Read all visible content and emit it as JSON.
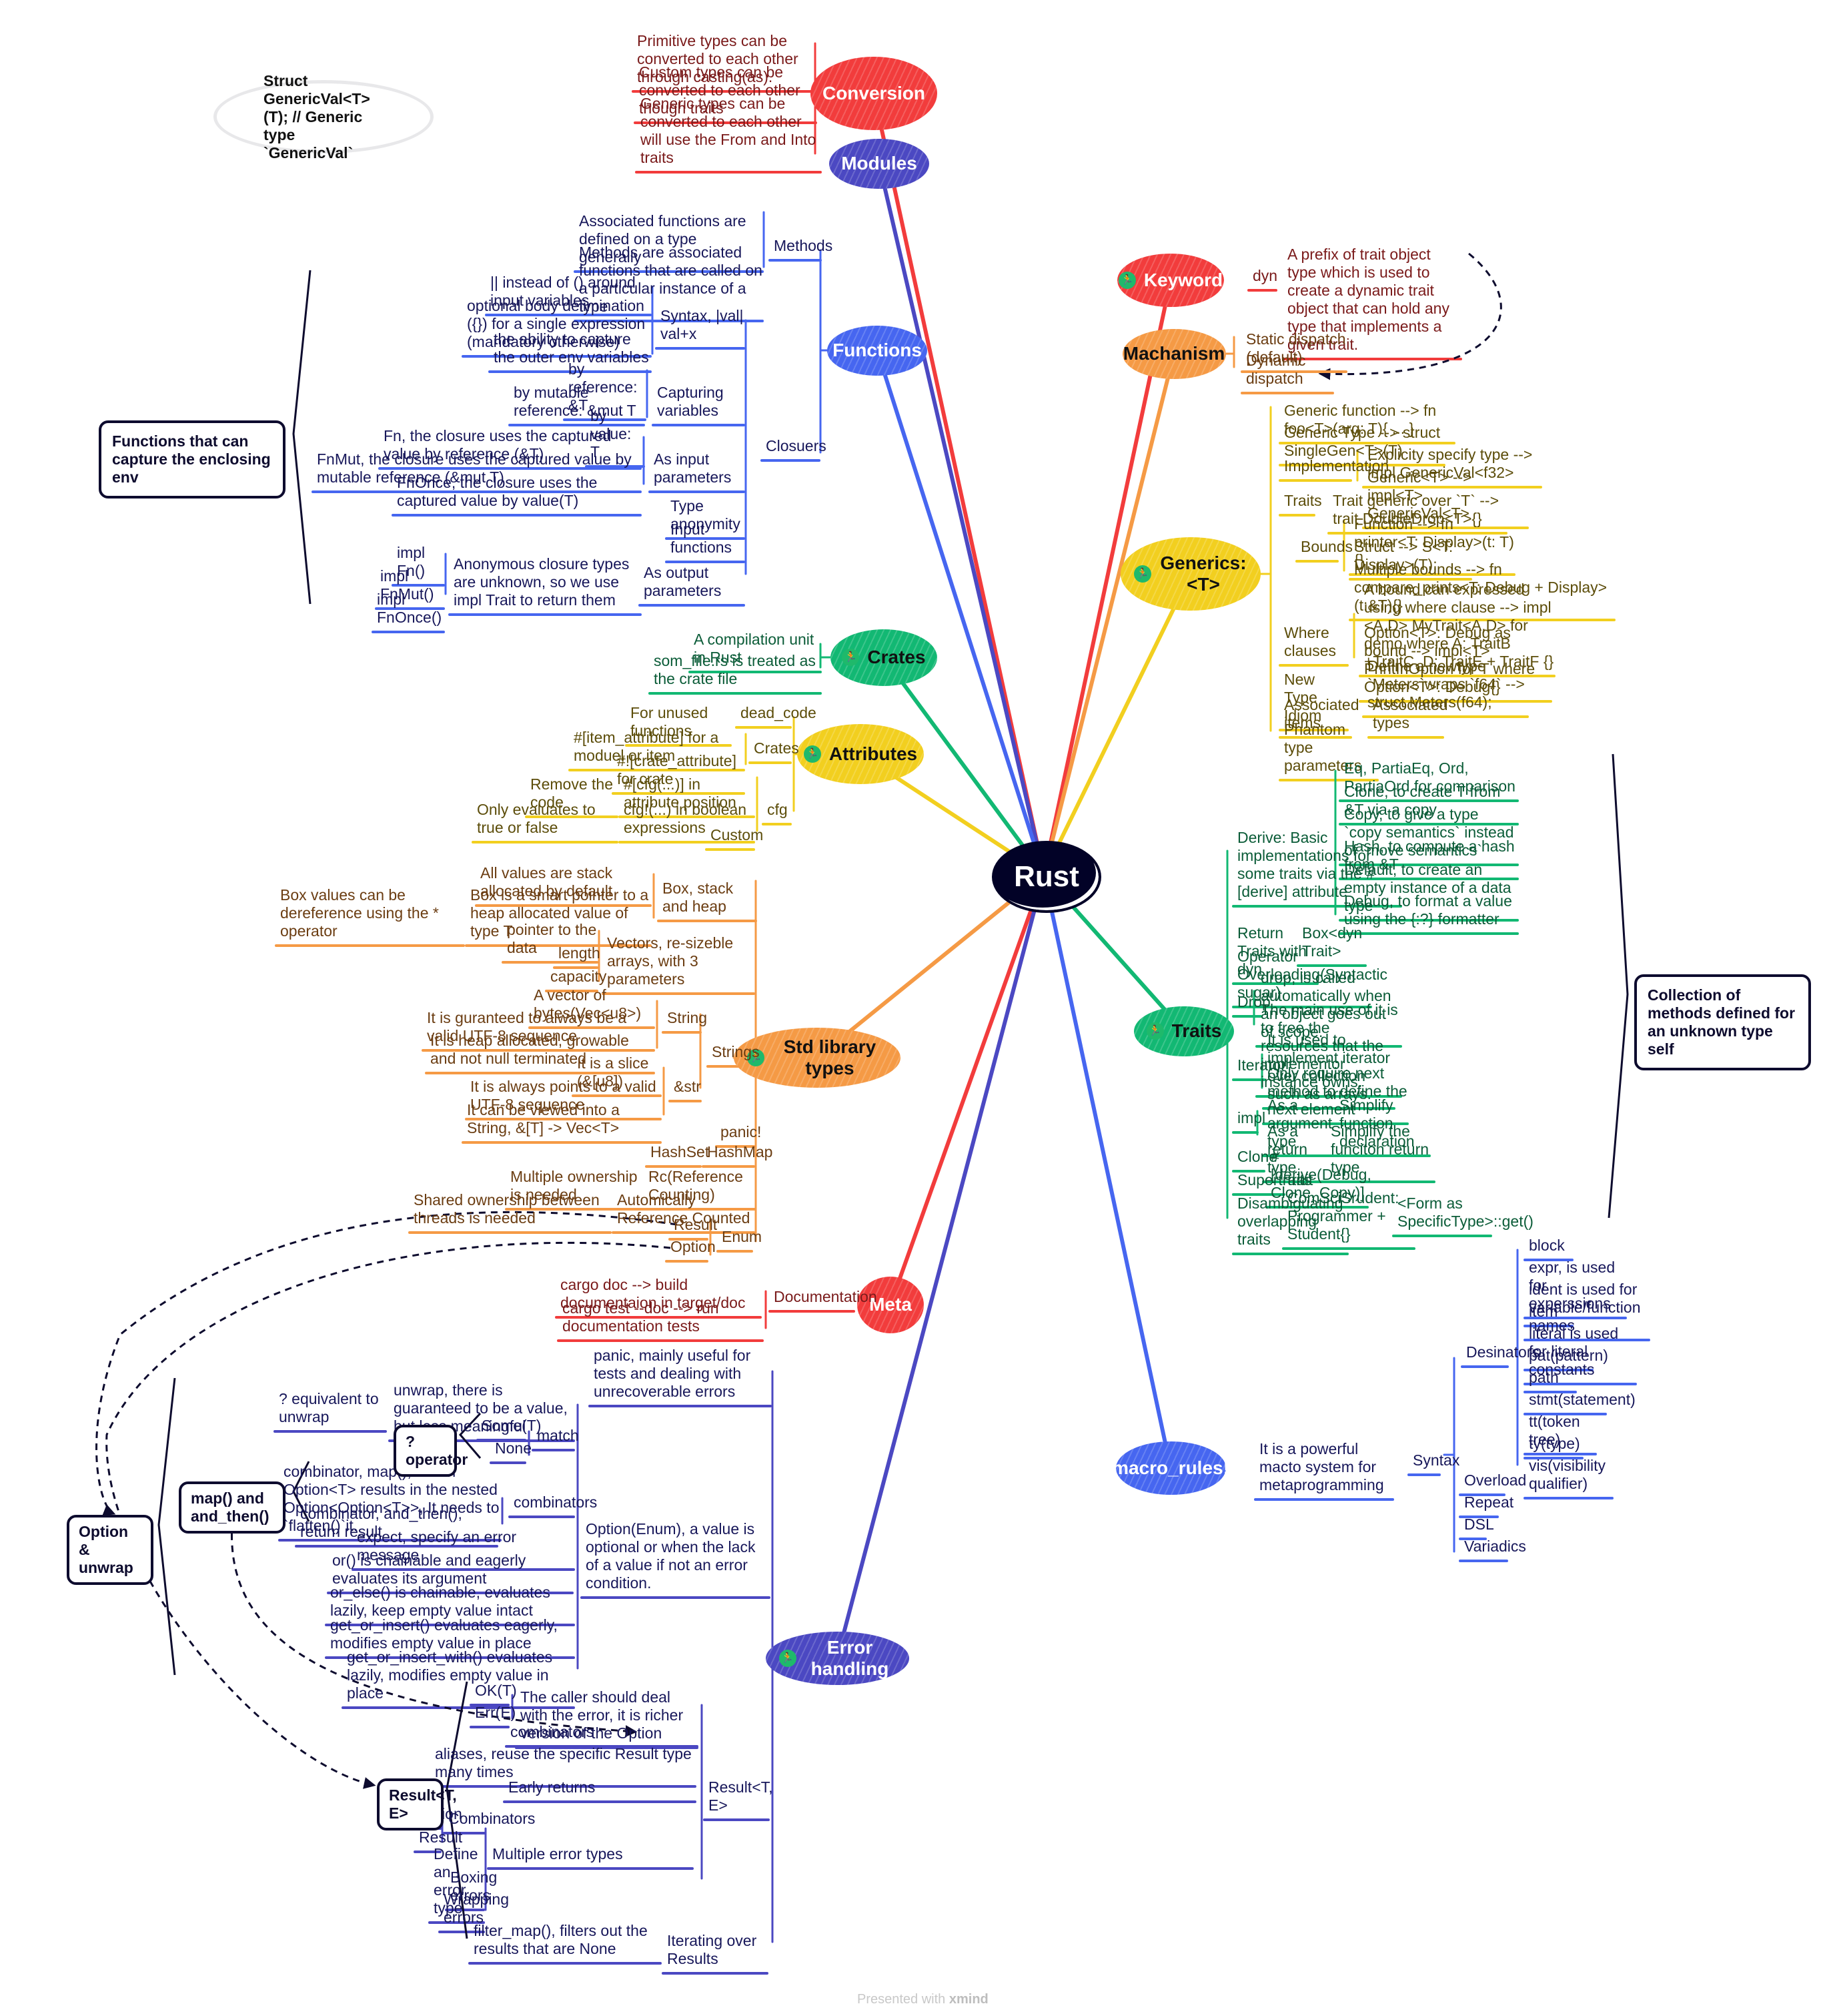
{
  "root": {
    "label": "Rust"
  },
  "colors": {
    "red": "#f23c3c",
    "indigo": "#4b48c2",
    "blue": "#4666f0",
    "green": "#12b873",
    "yellow": "#f2cf1f",
    "orange": "#f59a45",
    "text_red": "#7a1a1a",
    "text_navy": "#17175a",
    "text_green": "#0b5c38",
    "text_olive": "#5c4d0a",
    "text_brown": "#6b3d12",
    "callout": "#0d0b2e",
    "icon_green": "#1fb96b"
  },
  "note_oval": {
    "text": "Struct GenericVal<T>(T); // Generic type `GenericVal`"
  },
  "callouts": {
    "closure_def": "Functions that can capture the enclosing env",
    "traits_def": "Collection of methods defined for an unknown type self",
    "option_unwrap": "Option & unwrap",
    "map_and_then": "map() and and_then()",
    "question_operator": "? operator",
    "result_te": "Result<T, E>"
  },
  "branches": {
    "conversion": {
      "label": "Conversion",
      "children": [
        "Primitive types can be converted to each other through casting(as).",
        "Custom types can be converted to each other though traits",
        "Generic types can be converted to each other will use the From and Into traits"
      ]
    },
    "modules": {
      "label": "Modules"
    },
    "functions": {
      "label": "Functions",
      "methods": {
        "label": "Methods",
        "children": [
          "Associated functions are defined on a type generally",
          "Methods are associated functions that are called on a particular instance of a type"
        ]
      },
      "closures": {
        "label": "Closuers",
        "syntax": {
          "label": "Syntax, |val| val+x",
          "children": [
            "|| instead of () around input variables",
            "optional body delimination ({}) for a single expression (mandatory otherwise)",
            "the ability to capture the outer env variables"
          ]
        },
        "capturing": {
          "label": "Capturing variables",
          "children": [
            "by reference: &T",
            "by mutable reference: &mut T",
            "by value: T"
          ]
        },
        "input_params": {
          "label": "As input parameters",
          "children": [
            "Fn, the closure uses the captured value by reference (&T)",
            "FnMut, the closure uses the captured value by mutable reference (&mut T)",
            "FnOnce, the closure uses the captured value by value(T)"
          ]
        },
        "type_anonymity": "Type anonymity",
        "input_functions": "Input functions",
        "output_params": {
          "label": "As output parameters",
          "note": "Anonymous closure types are unknown, so we use impl Trait to return them",
          "children": [
            "impl Fn()",
            "impl FnMut()",
            "impl FnOnce()"
          ]
        }
      }
    },
    "crates": {
      "label": "Crates",
      "children": [
        "A compilation unit in Rust",
        "som_file.rs is treated as the crate file"
      ]
    },
    "attributes": {
      "label": "Attributes",
      "dead_code": {
        "label": "dead_code",
        "child": "For unused functions"
      },
      "crates": {
        "label": "Crates",
        "children": [
          "#[item_attribute] for a moduel or item",
          "#![crate_attribute] for crate"
        ]
      },
      "cfg": {
        "label": "cfg",
        "attr_pos": {
          "label": "#[cfg(...)] in attribute position",
          "child": "Remove the code"
        },
        "bool_expr": {
          "label": "cfg!(...) in boolean expressions",
          "child": "Only evaluates to true or false"
        },
        "custom": "Custom"
      }
    },
    "std_types": {
      "label": "Std library types",
      "box": {
        "label": "Box, stack and heap",
        "children": [
          "All values are stack allocated by default",
          "Box is a smart pointer to a heap allocated value of type T"
        ],
        "deref": "Box values can be dereference using the * operator"
      },
      "vectors": {
        "label": "Vectors, re-sizeble arrays, with 3 parameters",
        "children": [
          "pointer to the data",
          "length",
          "capacity"
        ]
      },
      "strings": {
        "label": "Strings",
        "string": {
          "label": "String",
          "children": [
            "A vector of bytes(Vec<u8>)",
            "It is guranteed to always be a valid UTF-8 sequence",
            "It is heap allocated, growable and not null terminated"
          ]
        },
        "str": {
          "label": "&str",
          "children": [
            "It is a slice (&[u8])",
            "It is always points to a valid UTF-8 sequence",
            "It can be viewed into a String, &[T] -> Vec<T>"
          ]
        }
      },
      "panic": "panic!",
      "hashmap": {
        "label": "HashMap",
        "child": "HashSet"
      },
      "rc": {
        "label": "Rc(Reference Counting)",
        "child": "Multiple ownership is needed"
      },
      "arc": {
        "label": "Automically Reference Counted",
        "child": "Shared ownership between threads is needed"
      },
      "enum": {
        "label": "Enum",
        "children": [
          "Result",
          "Option"
        ]
      }
    },
    "meta": {
      "label": "Meta",
      "documentation": {
        "label": "Documentation",
        "children": [
          "cargo doc --> build documentaion in target/doc",
          "cargo test --doc --> run documentation tests"
        ]
      }
    },
    "error_handling": {
      "label": "Error handling",
      "panic": "panic, mainly useful for tests and dealing with unrecoverable errors",
      "option": {
        "label": "Option(Enum), a value is optional or when the lack of a value if not an error condition.",
        "unwrap": {
          "label": "unwrap, there is guaranteed to be a value, but less meaningful",
          "child": "? equivalent to unwrap"
        },
        "match": {
          "label": "match",
          "children": [
            "Some(T)",
            "None"
          ]
        },
        "combinators": {
          "label": "combinators",
          "children": [
            "combinator, map(), return Option<T> results in the nested Option<Option<T>>, It needs to `flatten()`it.",
            "combinator, and_then(), return result"
          ]
        },
        "items": [
          "expect, specify an error message",
          "or() is chainable and eagerly evaluates its argument",
          "or_else() is chainable, evaluates lazily, keep empty value intact",
          "get_or_insert() evaluates eagerly, modifies empty value in place",
          "get_or_insert_with() evaluates lazily, modifies empty value in place"
        ]
      },
      "result": {
        "label": "Result<T, E>",
        "variants": {
          "label": "The caller should deal with the error, it is richer version of the Option",
          "children": [
            "OK(T)",
            "Err(E)"
          ]
        },
        "combinators": "combinators",
        "aliases": "aliases, reuse the specific Result type many times",
        "early_returns": "Early returns",
        "multiple_errors": {
          "label": "Multiple error types",
          "combinators": {
            "label": "Combinators",
            "children": [
              "Option",
              "Result"
            ]
          },
          "children": [
            "Define an error type",
            "Boxing errors",
            "Wrapping errors"
          ]
        }
      },
      "iterating": {
        "label": "Iterating over Results",
        "child": "filter_map(), filters out the results that are None"
      }
    },
    "keyword": {
      "label": "Keyword",
      "dyn": {
        "label": "dyn",
        "child": "A prefix of trait object type which is used to create a dynamic trait object that can hold any type that implements a given trait."
      }
    },
    "mechanism": {
      "label": "Machanism",
      "children": [
        "Static dispatch (default)",
        "Dynamic dispatch"
      ]
    },
    "generics": {
      "label": "Generics: <T>",
      "generic_function": "Generic function --> fn foo<T>(arg: T){ ... }",
      "generic_type": "Generic Type --> struct SingleGen<T>(T)",
      "implementation": {
        "label": "Implementation",
        "children": [
          "Explicity specify type --> impl GenericVal<f32>",
          "Generic<T> --> impl<T> GenericVal<T>"
        ]
      },
      "traits": {
        "label": "Traits",
        "child": "Trait generic over `T` --> trait DoubleDrop<T>{}"
      },
      "bounds": {
        "label": "Bounds",
        "children": [
          "Function --> fn printer<T: Display>(t: T){}",
          "Struct --> S<T: Display>(T);",
          "Multiple bounds --> fn compare_prints<T: Debug + Display>(t:&T){}"
        ]
      },
      "where": {
        "label": "Where clauses",
        "children": [
          "A bound can expressed using where clause --> impl <A,D> MyTrait<A,D> for demo where A: TraitB +TraitC, D: TraitE + TraitF {}",
          "Option<T>: Debug as bound --> impl<T> PrintInOption for T where Option<T>: Debug{}"
        ]
      },
      "newtype": {
        "label": "New Type Idiom",
        "child": "Define a newtype `Meters`wraps `f64` --> struct Meters(f64);"
      },
      "associated": {
        "label": "Associated items",
        "child": "Associated types"
      },
      "phantom": "Phantom type parameters"
    },
    "traits": {
      "label": "Traits",
      "derive": {
        "label": "Derive: Basic implementations for some traits via the #[derive] attribute",
        "children": [
          "Eq, PartiaEq, Ord, PartiaOrd for comparison",
          "Clone, to create T from &T via a copy",
          "Copy, to give a type `copy semantics` instead of `move semantics`",
          "Hash, to compute a hash from &T",
          "Default, to create an empty instance of a data type",
          "Debug, to format a value using the {:?} formatter"
        ]
      },
      "return_dyn": {
        "label": "Return Traits with dyn",
        "child": "Box<dyn Trait>"
      },
      "operator_overloading": "Operator Overloading(Syntactic sugar)",
      "drop": {
        "label": "Drop",
        "children": [
          "drop, is called automatically when an object goes out of scope.",
          "The main use of it is to free the resources that the implementor instance owns."
        ]
      },
      "iterator": {
        "label": "Iterator",
        "children": [
          "It is used to implement iterator over collection such as arrays.",
          "Only require next method to define the next element"
        ]
      },
      "impl": {
        "label": "impl",
        "arg": {
          "label": "As a argument type",
          "child": "Simplify function declaration"
        },
        "ret": {
          "label": "As a return type",
          "child": "Simplify the funciton return type"
        }
      },
      "clone": {
        "label": "Clone",
        "child": "#[derive(Debug, Clone, Copy)]"
      },
      "supertraits": {
        "label": "Supertraits",
        "child": "trait ComSciSrudent: Programmer + Student{}"
      },
      "disambiguating": {
        "label": "Disambiguating overlapping traits",
        "child": "<Form as SpecificType>::get()"
      }
    },
    "macro_rules": {
      "label": "macro_rules!",
      "desc": "It is a powerful macto system for metaprogramming",
      "syntax": {
        "label": "Syntax",
        "designators": {
          "label": "Desinators",
          "children": [
            "block",
            "expr, is used for experssions",
            "ident is used for variable/function names",
            "item",
            "literal is used for literal constants",
            "pat(pattern)",
            "path",
            "stmt(statement)",
            "tt(token tree)",
            "ty(type)",
            "vis(visibility qualifier)"
          ]
        },
        "others": [
          "Overload",
          "Repeat",
          "DSL",
          "Variadics"
        ]
      }
    }
  },
  "footer": {
    "prefix": "Presented with ",
    "brand": "xmind"
  }
}
